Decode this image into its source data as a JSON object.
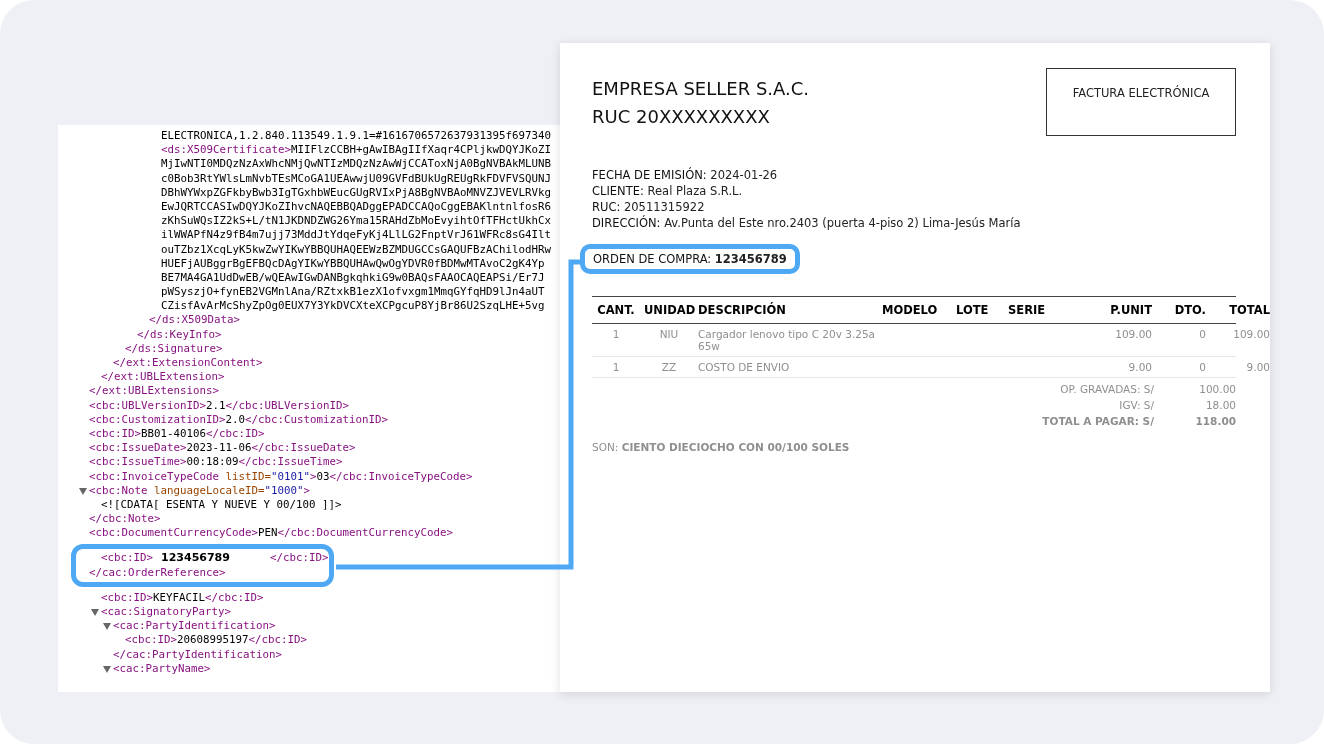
{
  "xml_viewer": {
    "nodes": [
      {
        "children": [
          {
            "children": [
              {
                "children": [
                  {
                    "children": [
                      {
                        "children": [
                          {
                            "children": [
                              {
                                "text": "ELECTRONICA,1.2.840.113549.1.9.1=#1616706572637931395f697340"
                              },
                              {
                                "text": "<ds:X509Certificate>MIIFlzCCBH+gAwIBAgIIfXaqr4CPljkwDQYJKoZI"
                              },
                              {
                                "text": "MjIwNTI0MDQzNzAxWhcNMjQwNTIzMDQzNzAwWjCCAToxNjA0BgNVBAkMLUNB"
                              },
                              {
                                "text": "c0Bob3RtYWlsLmNvbTEsMCoGA1UEAwwjU09GVFdBUkUgREUgRkFDVFVSQUNJ"
                              },
                              {
                                "text": "DBhWYWxpZGFkbyBwb3IgTGxhbWEucGUgRVIxPjA8BgNVBAoMNVZJVEVLRVkg"
                              },
                              {
                                "text": "EwJQRTCCASIwDQYJKoZIhvcNAQEBBQADggEPADCCAQoCggEBAKlntnlfosR6"
                              },
                              {
                                "text": "zKhSuWQsIZ2kS+L/tN1JKDNDZWG26Yma15RAHdZbMoEvyihtOfTFHctUkhCx"
                              },
                              {
                                "text": "ilWWAPfN4z9fB4m7ujj73MddJtYdqeFyKj4LlLG2FnptVrJ61WFRc8sG4Ilt"
                              },
                              {
                                "text": "ouTZbz1XcqLyK5kwZwYIKwYBBQUHAQEEWzBZMDUGCCsGAQUFBzAChilodHRw"
                              },
                              {
                                "text": "HUEFjAUBggrBgEFBQcDAgYIKwYBBQUHAwQwOgYDVR0fBDMwMTAvoC2gK4Yp"
                              },
                              {
                                "text": "BE7MA4GA1UdDwEB/wQEAwIGwDANBgkqhkiG9w0BAQsFAAOCAQEAPSi/Er7J"
                              },
                              {
                                "text": "pWSyszjO+fynEB2VGMnlAna/RZtxkB1ezX1ofvxgm1MmqGYfqHD9lJn4aUT"
                              },
                              {
                                "text": "CZisfAvArMcShyZpOg0EUX7Y3YkDVCXteXCPgcuP8YjBr86U2SzqLHE+5vg"
                              }
                            ]
                          },
                          {
                            "text": "</ds:X509Data>"
                          }
                        ]
                      },
                      {
                        "text": "</ds:KeyInfo>"
                      }
                    ]
                  },
                  {
                    "text": "</ds:Signature>"
                  }
                ]
              },
              {
                "text": "</ext:ExtensionContent>"
              }
            ]
          },
          {
            "text": "</ext:UBLExtension>"
          }
        ]
      },
      {
        "text": "</ext:UBLExtensions>"
      },
      {
        "text": "<cbc:UBLVersionID>2.1</cbc:UBLVersionID>"
      },
      {
        "text": "<cbc:CustomizationID>2.0</cbc:CustomizationID>"
      },
      {
        "text": "<cbc:ID>BB01-40106</cbc:ID>"
      },
      {
        "text": "<cbc:IssueDate>2023-11-06</cbc:IssueDate>"
      },
      {
        "text": "<cbc:IssueTime>00:18:09</cbc:IssueTime>"
      },
      {
        "text": "<cbc:InvoiceTypeCode listID=\"0101\">03</cbc:InvoiceTypeCode>"
      },
      {
        "text": "<cbc:Note languageLocaleID=\"1000\">",
        "expanded": true,
        "children": [
          {
            "text": "<![CDATA[ ESENTA Y NUEVE Y 00/100 ]]>"
          }
        ]
      },
      {
        "text": "</cbc:Note>"
      },
      {
        "text": "<cbc:DocumentCurrencyCode>PEN</cbc:DocumentCurrencyCode>"
      },
      {
        "highlighted": true,
        "items": [
          {
            "children": [
              {
                "text": "<cbc:ID>",
                "value": "123456789",
                "text_end": "</cbc:ID>"
              }
            ]
          },
          {
            "text": "</cac:OrderReference>"
          }
        ]
      },
      {
        "children": [
          {
            "text": "<cbc:ID>KEYFACIL</cbc:ID>"
          },
          {
            "text": "<cac:SignatoryParty>",
            "expanded": true,
            "children": [
              {
                "text": "<cac:PartyIdentification>",
                "expanded": true,
                "children": [
                  {
                    "text": "<cbc:ID>20608995197</cbc:ID>"
                  }
                ]
              },
              {
                "text": "</cac:PartyIdentification>"
              },
              {
                "text": "<cac:PartyName>",
                "expanded": true
              }
            ]
          }
        ]
      }
    ]
  },
  "invoice": {
    "company": "EMPRESA SELLER S.A.C.",
    "ruc": "RUC 20XXXXXXXXX",
    "doc_type": "FACTURA ELECTRÓNICA",
    "fields": [
      {
        "label": "FECHA DE EMISIÓN:",
        "value": "2024-01-26",
        "highlighted": false
      },
      {
        "label": "CLIENTE:",
        "value": "Real Plaza S.R.L.",
        "highlighted": false
      },
      {
        "label": "RUC:",
        "value": "20511315922",
        "highlighted": false
      },
      {
        "label": "DIRECCIÓN:",
        "value": "Av.Punta del Este nro.2403 (puerta 4-piso 2) Lima-Jesús María",
        "highlighted": false
      },
      {
        "label": "ORDEN DE COMPRA:",
        "value": "123456789",
        "highlighted": true
      }
    ],
    "columns": [
      "CANT.",
      "UNIDAD",
      "DESCRIPCIÓN",
      "MODELO",
      "LOTE",
      "SERIE",
      "P.UNIT",
      "DTO.",
      "TOTAL"
    ],
    "rows": [
      [
        "1",
        "NIU",
        "Cargador lenovo tipo C 20v 3.25a 65w",
        "",
        "",
        "",
        "109.00",
        "0",
        "109.00"
      ],
      [
        "1",
        "ZZ",
        "COSTO DE ENVIO",
        "",
        "",
        "",
        "9.00",
        "0",
        "9.00"
      ]
    ],
    "totals": [
      {
        "label": "OP. GRAVADAS: S/",
        "value": "100.00",
        "bold": false
      },
      {
        "label": "IGV: S/",
        "value": "18.00",
        "bold": false
      },
      {
        "label": "TOTAL A PAGAR: S/",
        "value": "118.00",
        "bold": true
      }
    ],
    "amount_words": "SON: **CIENTO DIECIOCHO CON 00/100 SOLES**"
  }
}
